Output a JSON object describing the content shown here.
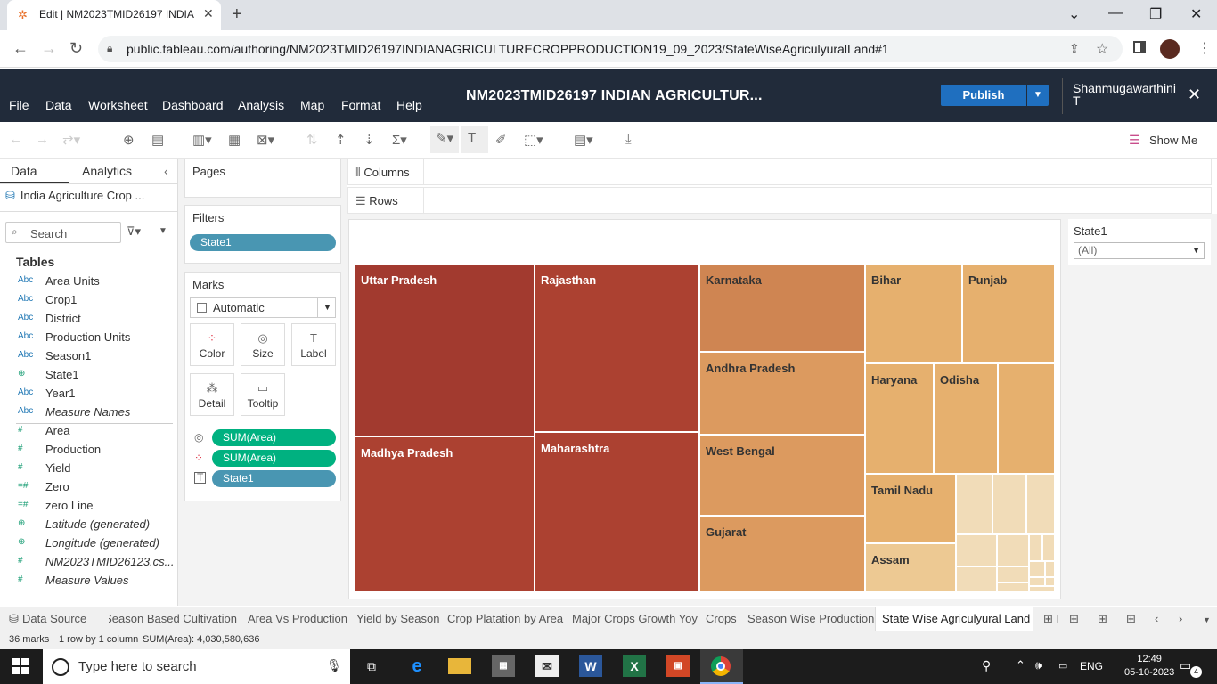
{
  "browser": {
    "tab_title": "Edit | NM2023TMID26197 INDIA",
    "new_tab": "+",
    "url": "public.tableau.com/authoring/NM2023TMID26197INDIANAGRICULTURECROPPRODUCTION19_09_2023/StateWiseAgriculyuralLand#1"
  },
  "tableau": {
    "menus": [
      "File",
      "Data",
      "Worksheet",
      "Dashboard",
      "Analysis",
      "Map",
      "Format",
      "Help"
    ],
    "workbook_title": "NM2023TMID26197 INDIAN AGRICULTUR...",
    "publish_label": "Publish",
    "user": "Shanmugawarthini T",
    "show_me": "Show Me"
  },
  "data_pane": {
    "tab_data": "Data",
    "tab_analytics": "Analytics",
    "datasource": "India Agriculture Crop ...",
    "search_placeholder": "Search",
    "tables_heading": "Tables",
    "fields": [
      {
        "type": "Abc",
        "name": "Area Units",
        "italic": false
      },
      {
        "type": "Abc",
        "name": "Crop1",
        "italic": false
      },
      {
        "type": "Abc",
        "name": "District",
        "italic": false
      },
      {
        "type": "Abc",
        "name": "Production Units",
        "italic": false
      },
      {
        "type": "Abc",
        "name": "Season1",
        "italic": false
      },
      {
        "type": "globe",
        "name": "State1",
        "italic": false
      },
      {
        "type": "Abc",
        "name": "Year1",
        "italic": false
      },
      {
        "type": "Abc",
        "name": "Measure Names",
        "italic": true
      },
      {
        "type": "#",
        "name": "Area",
        "italic": false
      },
      {
        "type": "#",
        "name": "Production",
        "italic": false
      },
      {
        "type": "#",
        "name": "Yield",
        "italic": false
      },
      {
        "type": "=#",
        "name": "Zero",
        "italic": false
      },
      {
        "type": "=#",
        "name": "zero Line",
        "italic": false
      },
      {
        "type": "globe",
        "name": "Latitude (generated)",
        "italic": true
      },
      {
        "type": "globe",
        "name": "Longitude (generated)",
        "italic": true
      },
      {
        "type": "#",
        "name": "NM2023TMID26123.cs...",
        "italic": true
      },
      {
        "type": "#",
        "name": "Measure Values",
        "italic": true
      }
    ]
  },
  "cards": {
    "pages": "Pages",
    "filters": "Filters",
    "filter_pill": "State1",
    "marks": "Marks",
    "mark_type": "Automatic",
    "buttons": [
      "Color",
      "Size",
      "Label",
      "Detail",
      "Tooltip"
    ],
    "mark_pills": [
      "SUM(Area)",
      "SUM(Area)",
      "State1"
    ]
  },
  "shelves": {
    "columns": "Columns",
    "rows": "Rows"
  },
  "treemap": {
    "labels": [
      "Uttar Pradesh",
      "Madhya Pradesh",
      "Rajasthan",
      "Maharashtra",
      "Karnataka",
      "Andhra Pradesh",
      "West Bengal",
      "Gujarat",
      "Bihar",
      "Punjab",
      "Haryana",
      "Odisha",
      "Tamil Nadu",
      "Assam"
    ],
    "colors": {
      "dark": "#a23a2f",
      "dark2": "#ac4131",
      "mid": "#cf8552",
      "mid2": "#dc9a5f",
      "light": "#e6b06e",
      "lighter": "#edc993",
      "pale": "#f1dcb8"
    }
  },
  "filter_card": {
    "title": "State1",
    "value": "(All)"
  },
  "sheet_tabs": [
    "Data Source",
    "Season Based Cultivation",
    "Area Vs Production",
    "Yield by Season",
    "Crop Platation by Area",
    "Major Crops Growth Yoy",
    "Crops",
    "Season Wise Production",
    "State Wise Agriculyural Land"
  ],
  "status": {
    "marks": "36 marks",
    "dims": "1 row by 1 column",
    "sum": "SUM(Area): 4,030,580,636"
  },
  "taskbar": {
    "search_placeholder": "Type here to search",
    "lang": "ENG",
    "time": "12:49",
    "date": "05-10-2023",
    "notif": "4"
  }
}
